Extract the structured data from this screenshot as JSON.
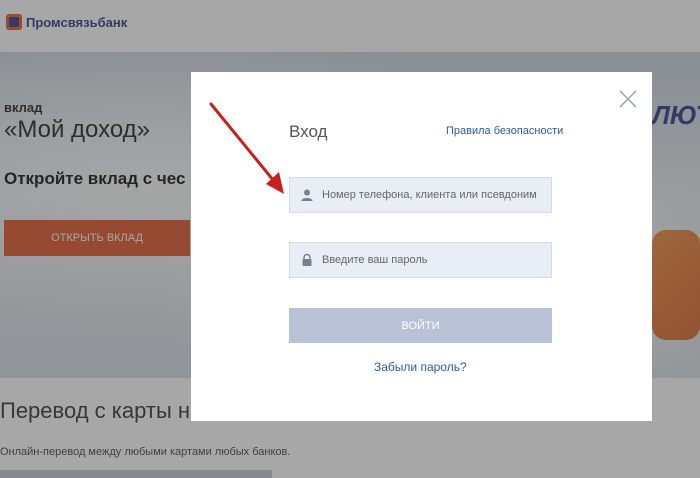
{
  "header": {
    "logo_text": "Промсвязьбанк"
  },
  "hero": {
    "small_label": "вклад",
    "title": "«Мой доход»",
    "subtitle": "Откройте вклад с чес",
    "button_label": "ОТКРЫТЬ ВКЛАД",
    "promo_text": "ЛЮТЬ"
  },
  "transfer": {
    "title": "Перевод с карты на",
    "description": "Онлайн-перевод между любыми картами любых банков."
  },
  "modal": {
    "title": "Вход",
    "security_link": "Правила безопасности",
    "login_placeholder": "Номер телефона, клиента или псевдоним",
    "password_placeholder": "Введите ваш пароль",
    "login_button": "ВОЙТИ",
    "forgot_link": "Забыли пароль?"
  },
  "colors": {
    "brand_blue": "#2e3a86",
    "accent_orange": "#e0562b",
    "link_blue": "#2b5aa8",
    "arrow_red": "#c8201e"
  }
}
